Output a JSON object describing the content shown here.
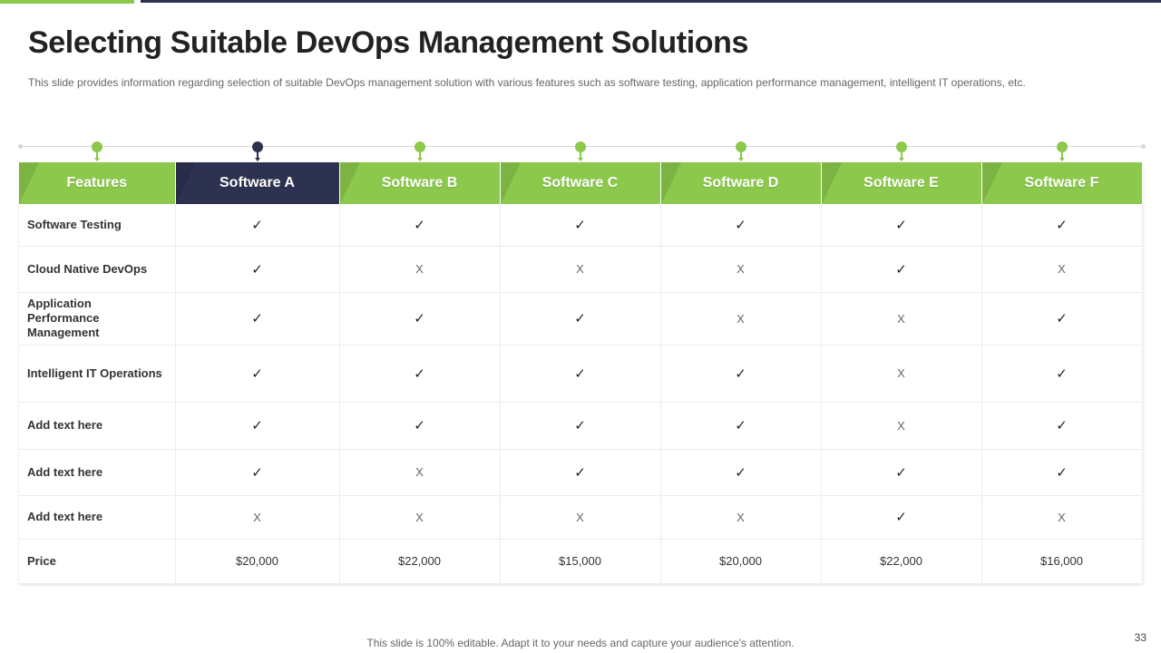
{
  "colors": {
    "green": "#8cc84b",
    "dark": "#2d3251",
    "top_dark": "#2d3251"
  },
  "slide": {
    "title": "Selecting Suitable DevOps Management Solutions",
    "subtitle": "This slide provides information regarding selection of suitable DevOps management solution with various features such as software testing, application performance management, intelligent IT operations, etc.",
    "footer": "This slide is 100% editable. Adapt it to your needs and capture your audience's attention.",
    "page_number": "33"
  },
  "table": {
    "headers": [
      "Features",
      "Software A",
      "Software B",
      "Software C",
      "Software D",
      "Software E",
      "Software F"
    ],
    "highlight_column": 1,
    "rows": [
      {
        "feature": "Software Testing",
        "marks": [
          "✓",
          "✓",
          "✓",
          "✓",
          "✓",
          "✓"
        ]
      },
      {
        "feature": "Cloud Native DevOps",
        "marks": [
          "✓",
          "X",
          "X",
          "X",
          "✓",
          "X"
        ]
      },
      {
        "feature": "Application Performance Management",
        "marks": [
          "✓",
          "✓",
          "✓",
          "X",
          "X",
          "✓"
        ]
      },
      {
        "feature": "Intelligent IT Operations",
        "marks": [
          "✓",
          "✓",
          "✓",
          "✓",
          "X",
          "✓"
        ]
      },
      {
        "feature": "Add text here",
        "marks": [
          "✓",
          "✓",
          "✓",
          "✓",
          "X",
          "✓"
        ]
      },
      {
        "feature": "Add text here",
        "marks": [
          "✓",
          "X",
          "✓",
          "✓",
          "✓",
          "✓"
        ]
      },
      {
        "feature": "Add text here",
        "marks": [
          "X",
          "X",
          "X",
          "X",
          "✓",
          "X"
        ]
      },
      {
        "feature": "Price",
        "marks": [
          "$20,000",
          "$22,000",
          "$15,000",
          "$20,000",
          "$22,000",
          "$16,000"
        ]
      }
    ]
  }
}
